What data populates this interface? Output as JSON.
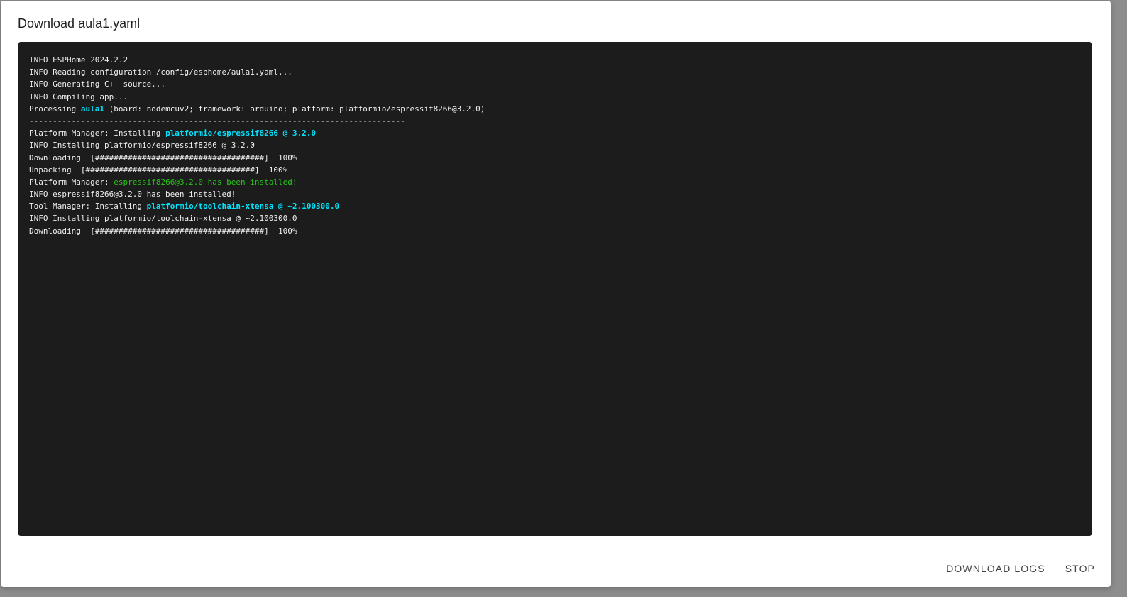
{
  "dialog": {
    "title": "Download aula1.yaml"
  },
  "log": {
    "lines": [
      [
        {
          "t": "INFO ESPHome 2024.2.2"
        }
      ],
      [
        {
          "t": "INFO Reading configuration /config/esphome/aula1.yaml..."
        }
      ],
      [
        {
          "t": "INFO Generating C++ source..."
        }
      ],
      [
        {
          "t": "INFO Compiling app..."
        }
      ],
      [
        {
          "t": "Processing "
        },
        {
          "t": "aula1",
          "c": "cyan"
        },
        {
          "t": " (board: nodemcuv2; framework: arduino; platform: platformio/espressif8266@3.2.0)"
        }
      ],
      [
        {
          "t": "--------------------------------------------------------------------------------"
        }
      ],
      [
        {
          "t": "Platform Manager: Installing "
        },
        {
          "t": "platformio/espressif8266 @ 3.2.0",
          "c": "cyan"
        }
      ],
      [
        {
          "t": "INFO Installing platformio/espressif8266 @ 3.2.0"
        }
      ],
      [
        {
          "t": "Downloading  [####################################]  100%"
        }
      ],
      [
        {
          "t": "Unpacking  [####################################]  100%"
        }
      ],
      [
        {
          "t": "Platform Manager: "
        },
        {
          "t": "espressif8266@3.2.0 has been installed!",
          "c": "green"
        }
      ],
      [
        {
          "t": "INFO espressif8266@3.2.0 has been installed!"
        }
      ],
      [
        {
          "t": "Tool Manager: Installing "
        },
        {
          "t": "platformio/toolchain-xtensa @ ~2.100300.0",
          "c": "cyan"
        }
      ],
      [
        {
          "t": "INFO Installing platformio/toolchain-xtensa @ ~2.100300.0"
        }
      ],
      [
        {
          "t": "Downloading  [####################################]  100%"
        }
      ]
    ]
  },
  "actions": {
    "download_logs": "DOWNLOAD LOGS",
    "stop": "STOP"
  },
  "colors": {
    "terminal_bg": "#1c1c1c",
    "terminal_text": "#eeeeee",
    "highlight_cyan": "#00e5ff",
    "success_green": "#27c417"
  }
}
